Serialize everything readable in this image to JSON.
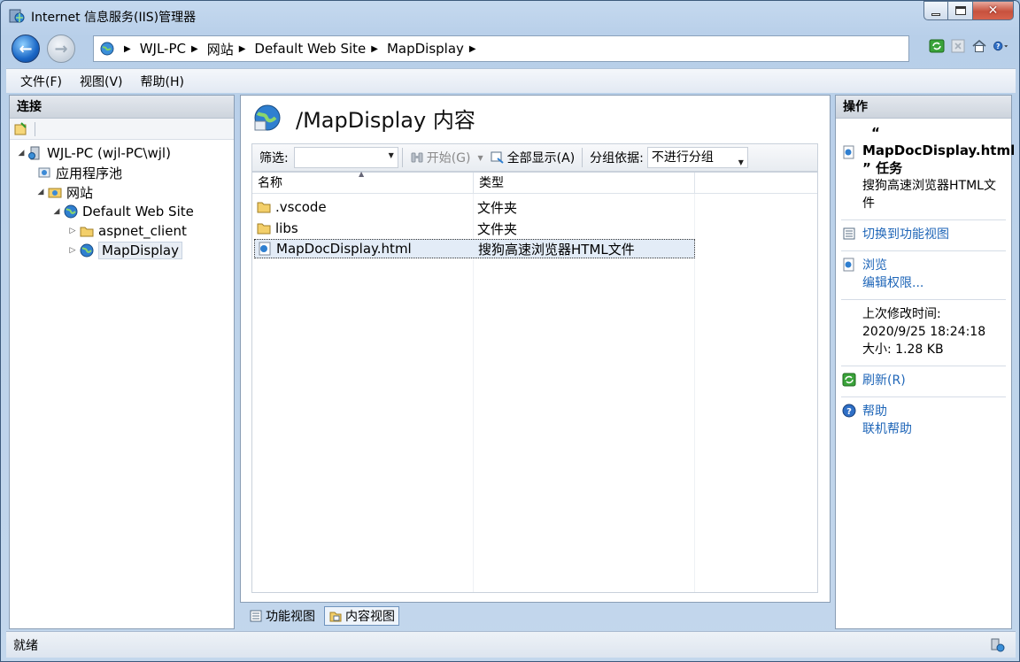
{
  "window": {
    "title": "Internet 信息服务(IIS)管理器",
    "minimize_glyph": "",
    "close_glyph": "✕"
  },
  "navigation": {
    "back_glyph": "←",
    "forward_glyph": "→",
    "breadcrumbs": [
      "WJL-PC",
      "网站",
      "Default Web Site",
      "MapDisplay"
    ],
    "separator": "▶"
  },
  "menu": {
    "items": [
      "文件(F)",
      "视图(V)",
      "帮助(H)"
    ]
  },
  "connections": {
    "header": "连接",
    "tree": [
      {
        "label": "WJL-PC (wjl-PC\\wjl)",
        "icon": "server-icon",
        "expander": "◢"
      },
      {
        "label": "应用程序池",
        "icon": "app-pool-icon",
        "expander": ""
      },
      {
        "label": "网站",
        "icon": "sites-folder-icon",
        "expander": "◢"
      },
      {
        "label": "Default Web Site",
        "icon": "globe-icon",
        "expander": "◢"
      },
      {
        "label": "aspnet_client",
        "icon": "folder-icon",
        "expander": "▷"
      },
      {
        "label": "MapDisplay",
        "icon": "web-app-icon",
        "expander": "▷"
      }
    ]
  },
  "content": {
    "title": "/MapDisplay 内容",
    "filter_label": "筛选:",
    "go_label": "开始(G)",
    "show_all_label": "全部显示(A)",
    "group_by_label": "分组依据:",
    "group_by_value": "不进行分组",
    "columns": [
      "名称",
      "类型"
    ],
    "rows": [
      {
        "name": ".vscode",
        "type": "文件夹",
        "icon": "folder-icon"
      },
      {
        "name": "libs",
        "type": "文件夹",
        "icon": "folder-icon"
      },
      {
        "name": "MapDocDisplay.html",
        "type": "搜狗高速浏览器HTML文件",
        "icon": "html-file-icon",
        "selected": true
      }
    ]
  },
  "tabs": {
    "features_view": "功能视图",
    "content_view": "内容视图"
  },
  "actions": {
    "header": "操作",
    "file_title_open": "“",
    "file_title_name": "MapDocDisplay.html",
    "file_title_close": "” 任务",
    "file_type": "搜狗高速浏览器HTML文件",
    "switch_view": "切换到功能视图",
    "browse": "浏览",
    "edit_permissions": "编辑权限...",
    "modified_label": "上次修改时间:",
    "modified_value": "2020/9/25 18:24:18",
    "size_label": "大小: 1.28 KB",
    "refresh": "刷新(R)",
    "help": "帮助",
    "online_help": "联机帮助"
  },
  "status": {
    "text": "就绪"
  },
  "colors": {
    "link": "#1f66b8",
    "selection": "#e3ecf7",
    "frame": "#c5d9ef"
  }
}
